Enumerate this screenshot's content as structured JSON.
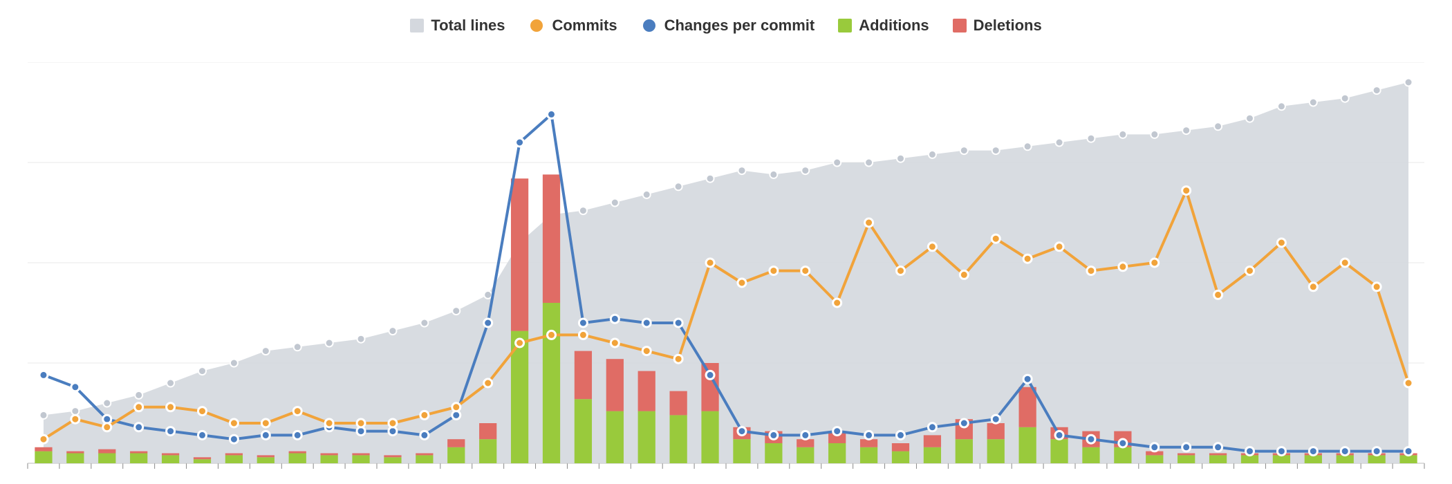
{
  "legend": {
    "total_lines": "Total lines",
    "commits": "Commits",
    "changes_per_commit": "Changes per commit",
    "additions": "Additions",
    "deletions": "Deletions"
  },
  "colors": {
    "total_lines_fill": "#d4d8de",
    "total_lines_dot": "#c1c7d0",
    "commits": "#f1a33a",
    "changes_per_commit": "#4a7dbf",
    "additions": "#99ca3c",
    "deletions": "#e06c65",
    "grid": "#e8e8e8",
    "axis": "#d0d0d0"
  },
  "chart_data": {
    "type": "composite",
    "x_count": 44,
    "ylim": [
      0,
      100
    ],
    "grid_y": [
      0,
      25,
      50,
      75,
      100
    ],
    "series": [
      {
        "name": "Total lines",
        "kind": "area",
        "color_key": "total_lines_fill",
        "dot_color_key": "total_lines_dot",
        "values": [
          12,
          13,
          15,
          17,
          20,
          23,
          25,
          28,
          29,
          30,
          31,
          33,
          35,
          38,
          42,
          55,
          62,
          63,
          65,
          67,
          69,
          71,
          73,
          72,
          73,
          75,
          75,
          76,
          77,
          78,
          78,
          79,
          80,
          81,
          82,
          82,
          83,
          84,
          86,
          89,
          90,
          91,
          93,
          95
        ]
      },
      {
        "name": "Additions",
        "kind": "stacked_bar_base",
        "color_key": "additions",
        "values": [
          3,
          2.5,
          2.5,
          2.5,
          2,
          1,
          2,
          1.5,
          2.5,
          2,
          2,
          1.5,
          2,
          4,
          6,
          33,
          40,
          16,
          13,
          13,
          12,
          13,
          6,
          5,
          4,
          5,
          4,
          3,
          4,
          6,
          6,
          9,
          6,
          4,
          4,
          2,
          2,
          2,
          2,
          2,
          2,
          2,
          2,
          2
        ]
      },
      {
        "name": "Deletions",
        "kind": "stacked_bar_top",
        "color_key": "deletions",
        "values": [
          1,
          0.5,
          1,
          0.5,
          0.5,
          0.5,
          0.5,
          0.5,
          0.5,
          0.5,
          0.5,
          0.5,
          0.5,
          2,
          4,
          38,
          32,
          12,
          13,
          10,
          6,
          12,
          3,
          3,
          2,
          3,
          2,
          2,
          3,
          5,
          4,
          10,
          3,
          4,
          4,
          1,
          0.5,
          0.5,
          0.5,
          0.5,
          0.5,
          0.5,
          0.5,
          0.5
        ]
      },
      {
        "name": "Commits",
        "kind": "line",
        "color_key": "commits",
        "values": [
          6,
          11,
          9,
          14,
          14,
          13,
          10,
          10,
          13,
          10,
          10,
          10,
          12,
          14,
          20,
          30,
          32,
          32,
          30,
          28,
          26,
          50,
          45,
          48,
          48,
          40,
          60,
          48,
          54,
          47,
          56,
          51,
          54,
          48,
          49,
          50,
          68,
          42,
          48,
          55,
          44,
          50,
          44,
          20
        ]
      },
      {
        "name": "Changes per commit",
        "kind": "line",
        "color_key": "changes_per_commit",
        "values": [
          22,
          19,
          11,
          9,
          8,
          7,
          6,
          7,
          7,
          9,
          8,
          8,
          7,
          12,
          35,
          80,
          87,
          35,
          36,
          35,
          35,
          22,
          8,
          7,
          7,
          8,
          7,
          7,
          9,
          10,
          11,
          21,
          7,
          6,
          5,
          4,
          4,
          4,
          3,
          3,
          3,
          3,
          3,
          3
        ]
      }
    ]
  }
}
